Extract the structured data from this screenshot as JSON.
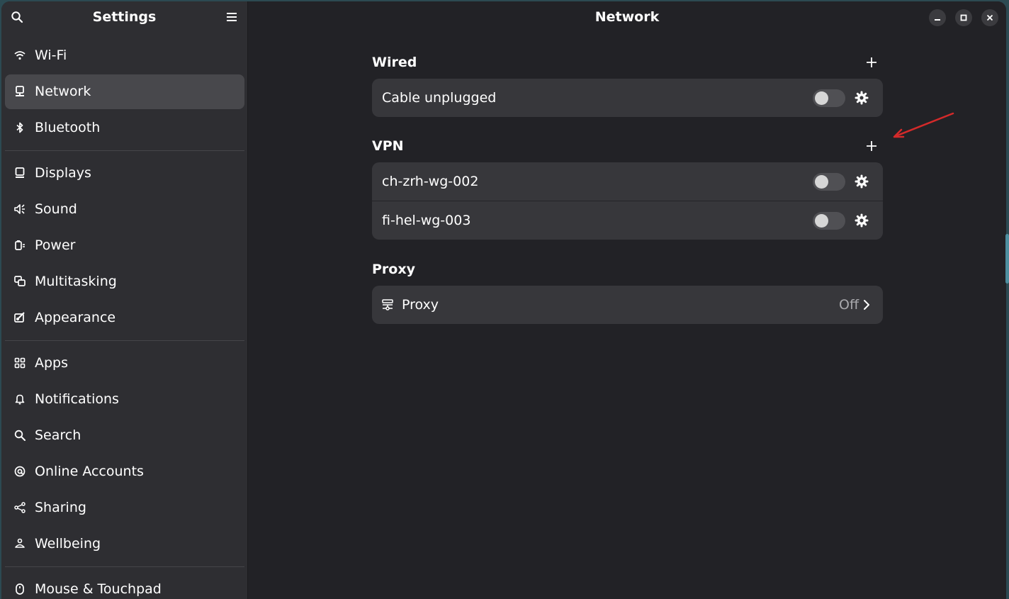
{
  "sidebar": {
    "title": "Settings",
    "search_icon": "search-icon",
    "menu_icon": "hamburger-menu-icon",
    "items": [
      {
        "label": "Wi-Fi",
        "icon": "wifi-icon"
      },
      {
        "label": "Network",
        "icon": "network-icon",
        "active": true
      },
      {
        "label": "Bluetooth",
        "icon": "bluetooth-icon"
      },
      {
        "label": "Displays",
        "icon": "display-icon"
      },
      {
        "label": "Sound",
        "icon": "speaker-icon"
      },
      {
        "label": "Power",
        "icon": "power-icon"
      },
      {
        "label": "Multitasking",
        "icon": "multitasking-icon"
      },
      {
        "label": "Appearance",
        "icon": "appearance-icon"
      },
      {
        "label": "Apps",
        "icon": "apps-grid-icon"
      },
      {
        "label": "Notifications",
        "icon": "bell-icon"
      },
      {
        "label": "Search",
        "icon": "search-icon"
      },
      {
        "label": "Online Accounts",
        "icon": "at-sign-icon"
      },
      {
        "label": "Sharing",
        "icon": "share-icon"
      },
      {
        "label": "Wellbeing",
        "icon": "wellbeing-icon"
      },
      {
        "label": "Mouse & Touchpad",
        "icon": "mouse-icon"
      }
    ]
  },
  "content": {
    "title": "Network",
    "window_controls": [
      "minimize-icon",
      "maximize-icon",
      "close-icon"
    ],
    "wired": {
      "title": "Wired",
      "rows": [
        {
          "name": "Cable unplugged",
          "enabled": false
        }
      ]
    },
    "vpn": {
      "title": "VPN",
      "rows": [
        {
          "name": "ch-zrh-wg-002",
          "enabled": false
        },
        {
          "name": "fi-hel-wg-003",
          "enabled": false
        }
      ]
    },
    "proxy": {
      "title": "Proxy",
      "row_label": "Proxy",
      "value": "Off"
    }
  },
  "colors": {
    "window_bg": "#222226",
    "sidebar_bg": "#2e2e32",
    "card_bg": "#37373b",
    "active_item": "#48484c",
    "annotation_arrow": "#d42a2a"
  }
}
